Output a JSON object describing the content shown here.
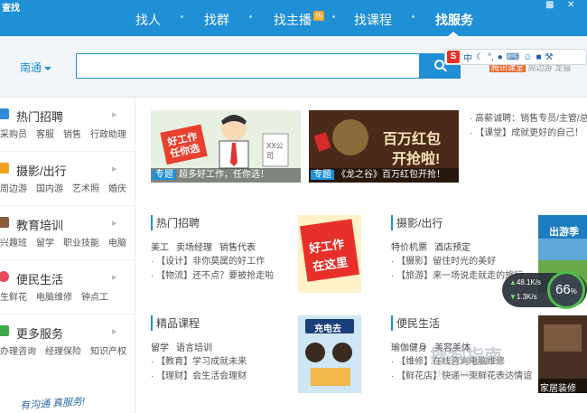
{
  "window": {
    "title": "查找"
  },
  "nav": {
    "items": [
      {
        "label": "找人"
      },
      {
        "label": "找群"
      },
      {
        "label": "找主播",
        "badge": "热"
      },
      {
        "label": "找课程"
      },
      {
        "label": "找服务"
      }
    ],
    "active": "找服务"
  },
  "search": {
    "city": "南通",
    "value": "",
    "placeholder": ""
  },
  "side_tags": {
    "badge": "腾讯课堂",
    "items": [
      "周边游",
      "龙猫"
    ]
  },
  "ime": {
    "logo": "S",
    "mode": "中"
  },
  "sidebar": {
    "categories": [
      {
        "title": "热门招聘",
        "subs": [
          "采购员",
          "客服",
          "销售",
          "行政助理"
        ]
      },
      {
        "title": "摄影/出行",
        "subs": [
          "周边游",
          "国内游",
          "艺术照",
          "婚庆"
        ]
      },
      {
        "title": "教育培训",
        "subs": [
          "兴趣班",
          "留学",
          "职业技能",
          "电脑"
        ]
      },
      {
        "title": "便民生活",
        "subs": [
          "生鲜花",
          "电脑维修",
          "钟点工"
        ]
      },
      {
        "title": "更多服务",
        "subs": [
          "办理咨询",
          "经理保险",
          "知识产权"
        ]
      }
    ],
    "slogan": "有沟通 真服务!"
  },
  "banners": [
    {
      "tag": "专题",
      "caption": "超多好工作，任你选！",
      "art_text": "好工作任你选",
      "note": "XX公司"
    },
    {
      "tag": "专题",
      "caption": "《龙之谷》百万红包开抢！",
      "art_text_1": "百万红包",
      "art_text_2": "开抢啦!"
    }
  ],
  "promos": [
    "高薪诚聘：销售专员/主管/总",
    "【课堂】成就更好的自己！"
  ],
  "blocks": {
    "jobs": {
      "title": "热门招聘",
      "tags": [
        "美工",
        "卖场经理",
        "销售代表"
      ],
      "news": [
        "【设计】非你莫属的好工作",
        "【物流】还不点？要被抢走啦"
      ],
      "thumb_text_1": "好工作",
      "thumb_text_2": "在这里"
    },
    "travel": {
      "title": "摄影/出行",
      "tags": [
        "特价机票",
        "酒店预定"
      ],
      "news": [
        "【摄影】留住时光的美好",
        "【旅游】来一场说走就走的旅行"
      ],
      "thumb_text": "出游季"
    },
    "courses": {
      "title": "精品课程",
      "tags": [
        "留学",
        "语言培训"
      ],
      "news": [
        "【教育】学习成就未来",
        "【理财】会生活会理财"
      ],
      "thumb_text": "充电去"
    },
    "life": {
      "title": "便民生活",
      "tags": [
        "瑜伽健身",
        "美容美体"
      ],
      "news": [
        "【维修】在线咨询电脑维修",
        "【鲜花店】快递一束鲜花表达情谊"
      ],
      "thumb_text": "家居装修"
    }
  },
  "speed": {
    "up": "48.1",
    "down": "1.3",
    "unit": "K/s",
    "percent": "66",
    "percent_unit": "%"
  },
  "watermark": {
    "main": "搜狗指南",
    "sub": "zhinan.sogou.com"
  }
}
